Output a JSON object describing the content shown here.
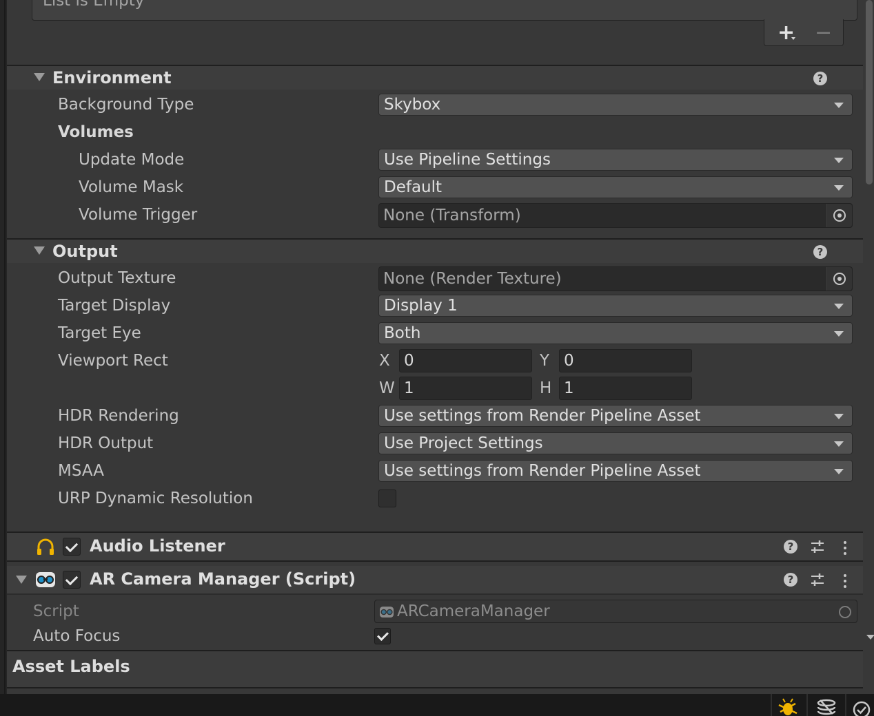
{
  "list": {
    "empty_text": "List is Empty",
    "add_label": "+",
    "remove_label": "−"
  },
  "environment": {
    "title": "Environment",
    "background_type": {
      "label": "Background Type",
      "value": "Skybox"
    },
    "volumes_label": "Volumes",
    "update_mode": {
      "label": "Update Mode",
      "value": "Use Pipeline Settings"
    },
    "volume_mask": {
      "label": "Volume Mask",
      "value": "Default"
    },
    "volume_trigger": {
      "label": "Volume Trigger",
      "value": "None (Transform)"
    }
  },
  "output": {
    "title": "Output",
    "output_texture": {
      "label": "Output Texture",
      "value": "None (Render Texture)"
    },
    "target_display": {
      "label": "Target Display",
      "value": "Display 1"
    },
    "target_eye": {
      "label": "Target Eye",
      "value": "Both"
    },
    "viewport_rect": {
      "label": "Viewport Rect",
      "x_label": "X",
      "x": "0",
      "y_label": "Y",
      "y": "0",
      "w_label": "W",
      "w": "1",
      "h_label": "H",
      "h": "1"
    },
    "hdr_rendering": {
      "label": "HDR Rendering",
      "value": "Use settings from Render Pipeline Asset"
    },
    "hdr_output": {
      "label": "HDR Output",
      "value": "Use Project Settings"
    },
    "msaa": {
      "label": "MSAA",
      "value": "Use settings from Render Pipeline Asset"
    },
    "urp_dynamic_resolution": {
      "label": "URP Dynamic Resolution",
      "checked": false
    }
  },
  "audio_listener": {
    "title": "Audio Listener",
    "enabled": true,
    "icon": "headphones-icon",
    "icon_color": "#f0b400"
  },
  "ar_camera_manager": {
    "title": "AR Camera Manager (Script)",
    "enabled": true,
    "script": {
      "label": "Script",
      "value": "ARCameraManager"
    },
    "auto_focus": {
      "label": "Auto Focus",
      "checked": true
    }
  },
  "asset_labels": {
    "title": "Asset Labels"
  },
  "colors": {
    "background": "#383838",
    "field": "#515151",
    "object_field": "#2a2a2a",
    "accent_yellow": "#f0b400"
  }
}
